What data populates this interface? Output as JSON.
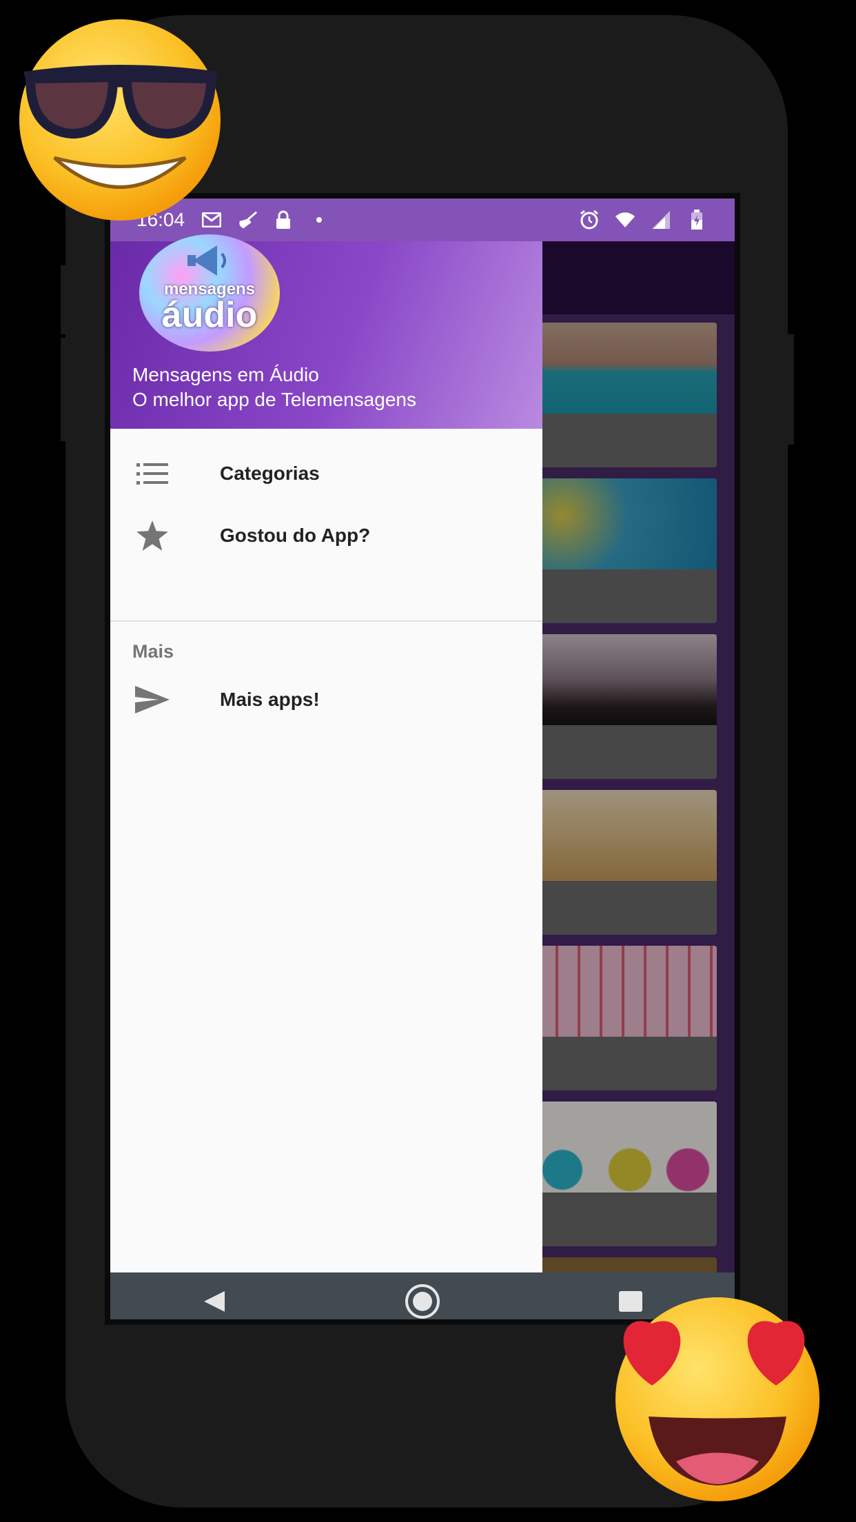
{
  "status_bar": {
    "time": "16:04",
    "left_icons": [
      "gmail-icon",
      "broom-icon",
      "lock-icon",
      "dot-icon"
    ],
    "right_icons": [
      "alarm-icon",
      "wifi-icon",
      "signal-icon",
      "battery-icon"
    ]
  },
  "drawer": {
    "header": {
      "logo_small_text": "mensagens",
      "logo_big_text": "áudio",
      "title": "Mensagens em Áudio",
      "subtitle": "O melhor app de Telemensagens"
    },
    "items": [
      {
        "label": "Categorias",
        "icon": "list-icon"
      },
      {
        "label": "Gostou do App?",
        "icon": "star-icon"
      }
    ],
    "section": {
      "label": "Mais",
      "items": [
        {
          "label": "Mais apps!",
          "icon": "send-icon"
        }
      ]
    }
  },
  "nav_bar": {
    "buttons": [
      "back-icon",
      "home-icon",
      "recents-icon"
    ]
  },
  "colors": {
    "status_bar": "#8453b7",
    "drawer_header_start": "#6a2aa8",
    "drawer_header_end": "#b98ae0",
    "app_bar": "#2a0f42",
    "content_bg": "#4a2c6b",
    "nav_bar": "#424a52",
    "phone_frame": "#1b1b1b"
  }
}
